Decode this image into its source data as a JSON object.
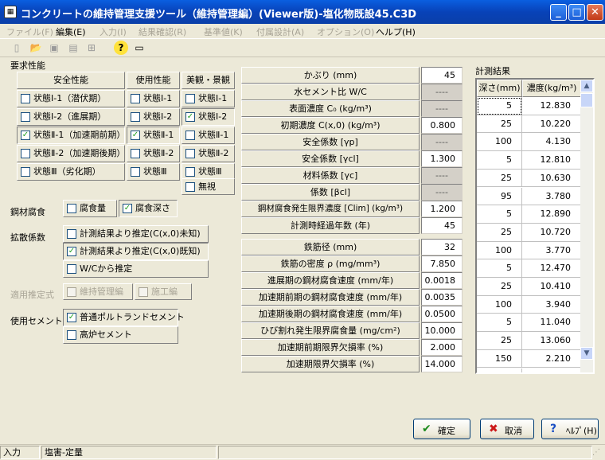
{
  "window": {
    "app_icon": "concrete-app-icon",
    "title": "コンクリートの維持管理支援ツール（維持管理編）(Viewer版)‐塩化物既設45.C3D",
    "minimize": "_",
    "maximize": "□",
    "close": "✕"
  },
  "menu": [
    {
      "label": "ファイル(F)",
      "enabled": false
    },
    {
      "label": "編集(E)",
      "enabled": true
    },
    {
      "label": "入力(I)",
      "enabled": false
    },
    {
      "label": "結果確認(R)",
      "enabled": false
    },
    {
      "label": "基準値(K)",
      "enabled": false
    },
    {
      "label": "付属設計(A)",
      "enabled": false
    },
    {
      "label": "オプション(O)",
      "enabled": false
    },
    {
      "label": "ヘルプ(H)",
      "enabled": true
    }
  ],
  "toolbar": {
    "icons": [
      "new-file-icon",
      "open-folder-icon",
      "save-icon",
      "print-preview-icon",
      "add-icon",
      "help-question-icon",
      "info-card-icon"
    ],
    "glyphs": [
      "▯",
      "📂",
      "▣",
      "▤",
      "⊞",
      "?",
      "▭"
    ]
  },
  "performance": {
    "section_label": "要求性能",
    "headers": [
      "安全性能",
      "使用性能",
      "美観・景観"
    ],
    "safety": [
      {
        "label": "状態Ⅰ-1（潜伏期）",
        "checked": false
      },
      {
        "label": "状態Ⅰ-2（進展期）",
        "checked": false
      },
      {
        "label": "状態Ⅱ-1（加速期前期）",
        "checked": true
      },
      {
        "label": "状態Ⅱ-2（加速期後期）",
        "checked": false
      },
      {
        "label": "状態Ⅲ（劣化期）",
        "checked": false
      }
    ],
    "usage": [
      {
        "label": "状態Ⅰ-1",
        "checked": false
      },
      {
        "label": "状態Ⅰ-2",
        "checked": false
      },
      {
        "label": "状態Ⅱ-1",
        "checked": true
      },
      {
        "label": "状態Ⅱ-2",
        "checked": false
      },
      {
        "label": "状態Ⅲ",
        "checked": false
      }
    ],
    "aesthetic": [
      {
        "label": "状態Ⅰ-1",
        "checked": false
      },
      {
        "label": "状態Ⅰ-2",
        "checked": true
      },
      {
        "label": "状態Ⅱ-1",
        "checked": false
      },
      {
        "label": "状態Ⅱ-2",
        "checked": false
      },
      {
        "label": "状態Ⅲ",
        "checked": false
      },
      {
        "label": "無視",
        "checked": false
      }
    ]
  },
  "corrosion": {
    "label": "鋼材腐食",
    "options": [
      {
        "label": "腐食量",
        "checked": false
      },
      {
        "label": "腐食深さ",
        "checked": true
      }
    ]
  },
  "diffusion": {
    "label": "拡散係数",
    "options": [
      {
        "label": "計測結果より推定(C(x,0)未知)",
        "checked": false
      },
      {
        "label": "計測結果より推定(C(x,0)既知)",
        "checked": true
      },
      {
        "label": "W/Cから推定",
        "checked": false
      }
    ]
  },
  "estimation": {
    "label": "適用推定式",
    "options": [
      {
        "label": "維持管理編",
        "checked": false
      },
      {
        "label": "施工編",
        "checked": false
      }
    ]
  },
  "cement": {
    "label": "使用セメント",
    "options": [
      {
        "label": "普通ポルトランドセメント",
        "checked": true
      },
      {
        "label": "高炉セメント",
        "checked": false
      }
    ]
  },
  "params_top": [
    {
      "label": "かぶり (mm)",
      "value": "45",
      "editable": true
    },
    {
      "label": "水セメント比 W/C",
      "value": "----",
      "editable": false
    },
    {
      "label": "表面濃度 C₀ (kg/m³)",
      "value": "----",
      "editable": false
    },
    {
      "label": "初期濃度 C(x,0) (kg/m³)",
      "value": "0.800",
      "editable": true
    },
    {
      "label": "安全係数 [γp]",
      "value": "----",
      "editable": false
    },
    {
      "label": "安全係数 [γcl]",
      "value": "1.300",
      "editable": true
    },
    {
      "label": "材料係数 [γc]",
      "value": "----",
      "editable": false
    },
    {
      "label": "係数 [βcl]",
      "value": "----",
      "editable": false
    },
    {
      "label": "鋼材腐食発生限界濃度 [Clim] (kg/m³)",
      "value": "1.200",
      "editable": true
    },
    {
      "label": "計測時経過年数 (年)",
      "value": "45",
      "editable": true
    }
  ],
  "params_bottom": [
    {
      "label": "鉄筋径 (mm)",
      "value": "32"
    },
    {
      "label": "鉄筋の密度 ρ (mg/mm³)",
      "value": "7.850"
    },
    {
      "label": "進展期の鋼材腐食速度 (mm/年)",
      "value": "0.0018"
    },
    {
      "label": "加速期前期の鋼材腐食速度 (mm/年)",
      "value": "0.0035"
    },
    {
      "label": "加速期後期の鋼材腐食速度 (mm/年)",
      "value": "0.0500"
    },
    {
      "label": "ひび割れ発生限界腐食量 (mg/cm²)",
      "value": "10.000"
    },
    {
      "label": "加速期前期限界欠損率 (%)",
      "value": "2.000"
    },
    {
      "label": "加速期限界欠損率 (%)",
      "value": "14.000"
    }
  ],
  "measurements": {
    "title": "計測結果",
    "col_depth": "深さ(mm)",
    "col_conc": "濃度(kg/m³)",
    "rows": [
      [
        "5",
        "12.830"
      ],
      [
        "25",
        "10.220"
      ],
      [
        "100",
        "4.130"
      ],
      [
        "5",
        "12.810"
      ],
      [
        "25",
        "10.630"
      ],
      [
        "95",
        "3.780"
      ],
      [
        "5",
        "12.890"
      ],
      [
        "25",
        "10.720"
      ],
      [
        "100",
        "3.770"
      ],
      [
        "5",
        "12.470"
      ],
      [
        "25",
        "10.410"
      ],
      [
        "100",
        "3.940"
      ],
      [
        "5",
        "11.040"
      ],
      [
        "25",
        "13.060"
      ],
      [
        "150",
        "2.210"
      ],
      [
        "",
        ""
      ]
    ],
    "scroll_up": "▲",
    "scroll_down": "▼"
  },
  "buttons": {
    "ok": {
      "label": "確定",
      "icon": "check-icon",
      "glyph": "✔",
      "color": "#1a8a1a"
    },
    "cancel": {
      "label": "取消",
      "icon": "cross-icon",
      "glyph": "✖",
      "color": "#cc1a1a"
    },
    "help": {
      "label": "ﾍﾙﾌﾟ(H)",
      "icon": "question-icon",
      "glyph": "?",
      "color": "#1a4fc4"
    }
  },
  "status": {
    "mode": "入力",
    "message": "塩害‐定量"
  }
}
